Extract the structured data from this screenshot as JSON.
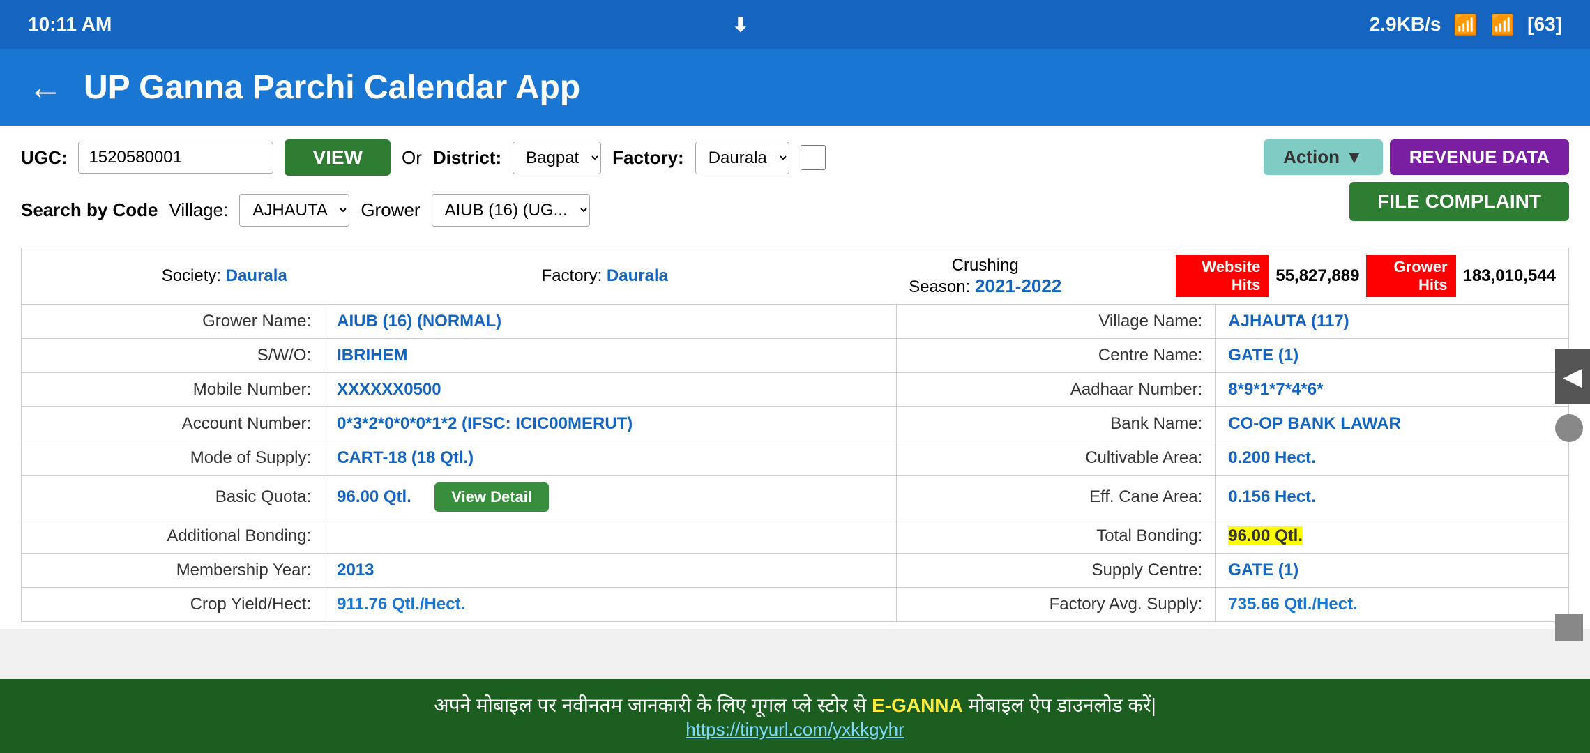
{
  "status_bar": {
    "time": "10:11 AM",
    "download_icon": "⬇",
    "speed": "2.9KB/s",
    "signal_icons": "📶",
    "battery": "63"
  },
  "header": {
    "back_icon": "←",
    "title": "UP Ganna Parchi Calendar App"
  },
  "controls": {
    "ugc_label": "UGC:",
    "ugc_value": "1520580001",
    "view_btn": "VIEW",
    "or_text": "Or",
    "district_label": "District:",
    "district_value": "Bagpat",
    "factory_label": "Factory:",
    "factory_value": "Daurala",
    "search_code_label": "Search by Code",
    "village_label": "Village:",
    "village_value": "AJHAUTA",
    "grower_label": "Grower",
    "grower_value": "AIUB (16) (UG..."
  },
  "buttons": {
    "action_label": "Action",
    "revenue_data_label": "REVENUE DATA",
    "file_complaint_label": "FILE COMPLAINT"
  },
  "table": {
    "society_label": "Society:",
    "society_value": "Daurala",
    "factory_label": "Factory:",
    "factory_value": "Daurala",
    "crushing_label": "Crushing",
    "season_label": "Season:",
    "season_value": "2021-2022",
    "website_hits_label": "Website Hits",
    "website_hits_count": "55,827,889",
    "grower_hits_label": "Grower Hits",
    "grower_hits_count": "183,010,544",
    "rows": [
      {
        "left_label": "Grower Name:",
        "left_value": "AIUB (16) (NORMAL)",
        "right_label": "Village Name:",
        "right_value": "AJHAUTA (117)"
      },
      {
        "left_label": "S/W/O:",
        "left_value": "IBRIHEM",
        "right_label": "Centre Name:",
        "right_value": "GATE (1)"
      },
      {
        "left_label": "Mobile Number:",
        "left_value": "XXXXXX0500",
        "right_label": "Aadhaar Number:",
        "right_value": "8*9*1*7*4*6*"
      },
      {
        "left_label": "Account Number:",
        "left_value": "0*3*2*0*0*0*1*2 (IFSC: ICIC00MERUT)",
        "right_label": "Bank Name:",
        "right_value": "CO-OP BANK LAWAR"
      },
      {
        "left_label": "Mode of Supply:",
        "left_value": "CART-18 (18 Qtl.)",
        "right_label": "Cultivable Area:",
        "right_value": "0.200 Hect."
      },
      {
        "left_label": "Basic Quota:",
        "left_value": "96.00 Qtl.",
        "view_detail_btn": "View Detail",
        "right_label": "Eff. Cane Area:",
        "right_value": "0.156 Hect."
      },
      {
        "left_label": "Additional Bonding:",
        "left_value": "",
        "right_label": "Total Bonding:",
        "right_value": "96.00 Qtl.",
        "right_highlighted": true
      },
      {
        "left_label": "Membership Year:",
        "left_value": "2013",
        "right_label": "Supply Centre:",
        "right_value": "GATE (1)"
      },
      {
        "left_label": "Crop Yield/Hect:",
        "left_value": "911.76 Qtl./Hect.",
        "right_label": "Factory Avg. Supply:",
        "right_value": "735.66 Qtl./Hect."
      }
    ]
  },
  "banner": {
    "text_before": "अपने मोबाइल पर नवीनतम जानकारी के लिए गूगल प्ले स्टोर से",
    "highlight": "E-GANNA",
    "text_after": "मोबाइल ऐप डाउनलोड करें|",
    "link": "https://tinyurl.com/yxkkgyhr"
  }
}
